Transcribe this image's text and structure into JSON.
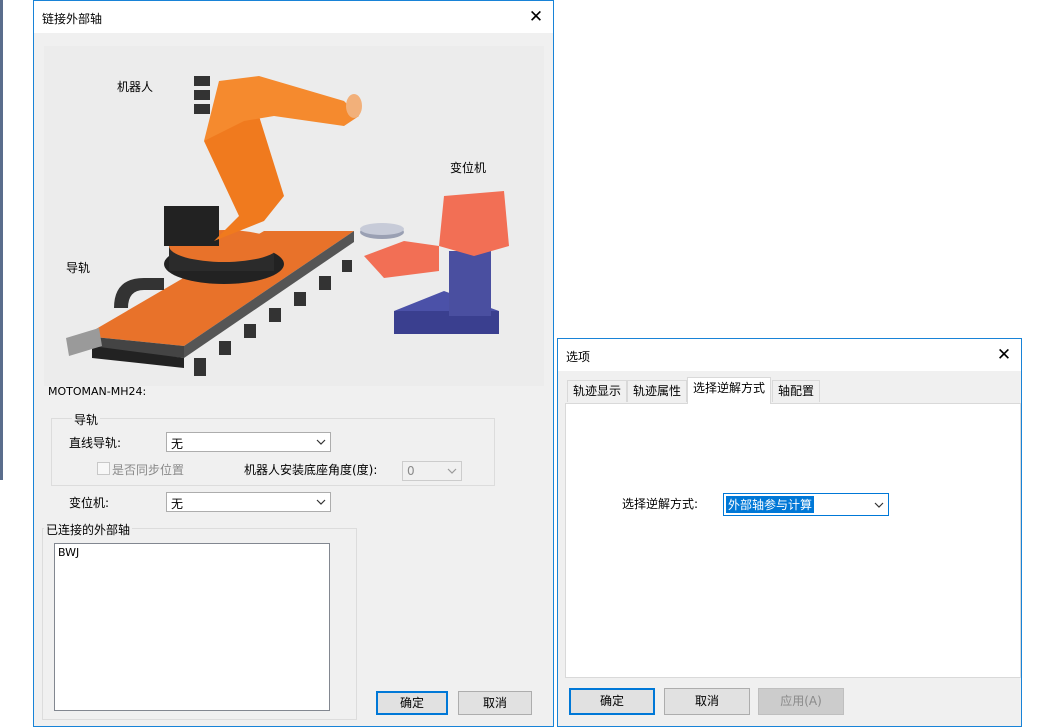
{
  "dialog1": {
    "title": "链接外部轴",
    "image_labels": {
      "robot": "机器人",
      "positioner": "变位机",
      "rail": "导轨"
    },
    "robot_model": "MOTOMAN-MH24:",
    "rail_group": {
      "legend": "导轨",
      "linear_rail_label": "直线导轨:",
      "linear_rail_value": "无",
      "sync_label": "是否同步位置",
      "sync_checked": false,
      "base_angle_label": "机器人安装底座角度(度):",
      "base_angle_value": "0"
    },
    "positioner_label": "变位机:",
    "positioner_value": "无",
    "connected_legend": "已连接的外部轴",
    "connected_items": [
      "BWJ"
    ],
    "ok": "确定",
    "cancel": "取消"
  },
  "dialog2": {
    "title": "选项",
    "tabs": [
      "轨迹显示",
      "轨迹属性",
      "选择逆解方式",
      "轴配置"
    ],
    "active_tab": 2,
    "solve_label": "选择逆解方式:",
    "solve_value": "外部轴参与计算",
    "ok": "确定",
    "cancel": "取消",
    "apply": "应用(A)"
  },
  "colors": {
    "accent": "#0078d7",
    "robot_orange": "#f07a1e",
    "positioner_salmon": "#f26f55",
    "base_navy": "#3a3f8f"
  }
}
